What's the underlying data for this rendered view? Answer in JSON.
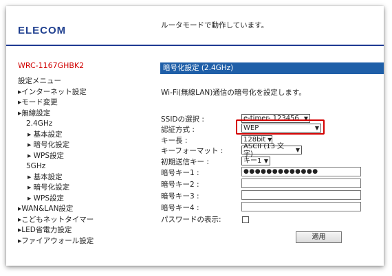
{
  "header": {
    "logo": "ELECOM",
    "status": "ルータモードで動作しています。"
  },
  "sidebar": {
    "model": "WRC-1167GHBK2",
    "menu_title": "設定メニュー",
    "items": [
      {
        "label": "▸インターネット設定"
      },
      {
        "label": "▸モード変更"
      },
      {
        "label": "▸無線設定"
      },
      {
        "label": "2.4GHz"
      },
      {
        "label": "▸ 基本設定"
      },
      {
        "label": "▸ 暗号化設定"
      },
      {
        "label": "▸ WPS設定"
      },
      {
        "label": "5GHz"
      },
      {
        "label": "▸ 基本設定"
      },
      {
        "label": "▸ 暗号化設定"
      },
      {
        "label": "▸ WPS設定"
      },
      {
        "label": "▸WAN&LAN設定"
      },
      {
        "label": "▸こどもネットタイマー"
      },
      {
        "label": "▸LED省電力設定"
      },
      {
        "label": "▸ファイアウォール設定"
      }
    ]
  },
  "main": {
    "title": "暗号化設定 (2.4GHz)",
    "description": "Wi-Fi(無線LAN)通信の暗号化を設定します。",
    "fields": {
      "ssid_label": "SSIDの選択 :",
      "ssid_value": "e-timer- 123456",
      "auth_label": "認証方式 :",
      "auth_value": "WEP",
      "keylen_label": "キー長 :",
      "keylen_value": "128bit",
      "keyformat_label": "キーフォーマット :",
      "keyformat_value": "ASCII (13 文字)",
      "initkey_label": "初期送信キー :",
      "initkey_value": "キー1",
      "key1_label": "暗号キー1 :",
      "key1_value": "●●●●●●●●●●●●●",
      "key2_label": "暗号キー2 :",
      "key3_label": "暗号キー3 :",
      "key4_label": "暗号キー4 :",
      "showpw_label": "パスワードの表示:"
    },
    "apply_label": "適用"
  },
  "colors": {
    "brand": "#1f3f8f",
    "title_bar": "#1f5fa8",
    "model_text": "#d00000",
    "highlight": "#d40000"
  }
}
